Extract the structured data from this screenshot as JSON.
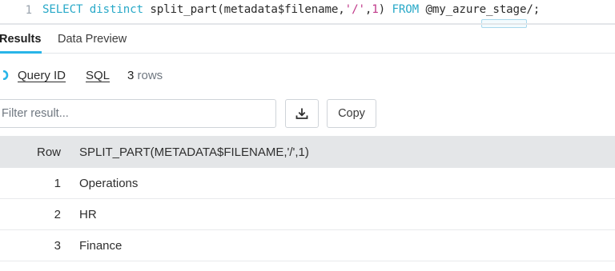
{
  "editor": {
    "line_number": "1",
    "tokens": {
      "kw_select": "SELECT",
      "kw_distinct": "distinct",
      "fn_call": "split_part(metadata$filename,",
      "str_slash": "'/'",
      "comma": ",",
      "num_one": "1",
      "close_paren": ")",
      "kw_from": "FROM",
      "stage": "@my_azure_stage/;"
    }
  },
  "tabs": {
    "results": "Results",
    "data_preview": "Data Preview"
  },
  "meta": {
    "query_id": "Query ID",
    "sql": "SQL",
    "row_count": "3",
    "row_label": "rows"
  },
  "filter": {
    "placeholder": "Filter result..."
  },
  "toolbar": {
    "download_icon": "download-icon",
    "copy_label": "Copy"
  },
  "table": {
    "headers": {
      "row": "Row",
      "column": "SPLIT_PART(METADATA$FILENAME,'/',1)"
    },
    "rows": [
      {
        "num": "1",
        "value": "Operations"
      },
      {
        "num": "2",
        "value": "HR"
      },
      {
        "num": "3",
        "value": "Finance"
      }
    ]
  },
  "colors": {
    "accent": "#29b5e8",
    "keyword": "#29a9c8",
    "string": "#c0398a",
    "header_bg": "#e4e6e8"
  }
}
